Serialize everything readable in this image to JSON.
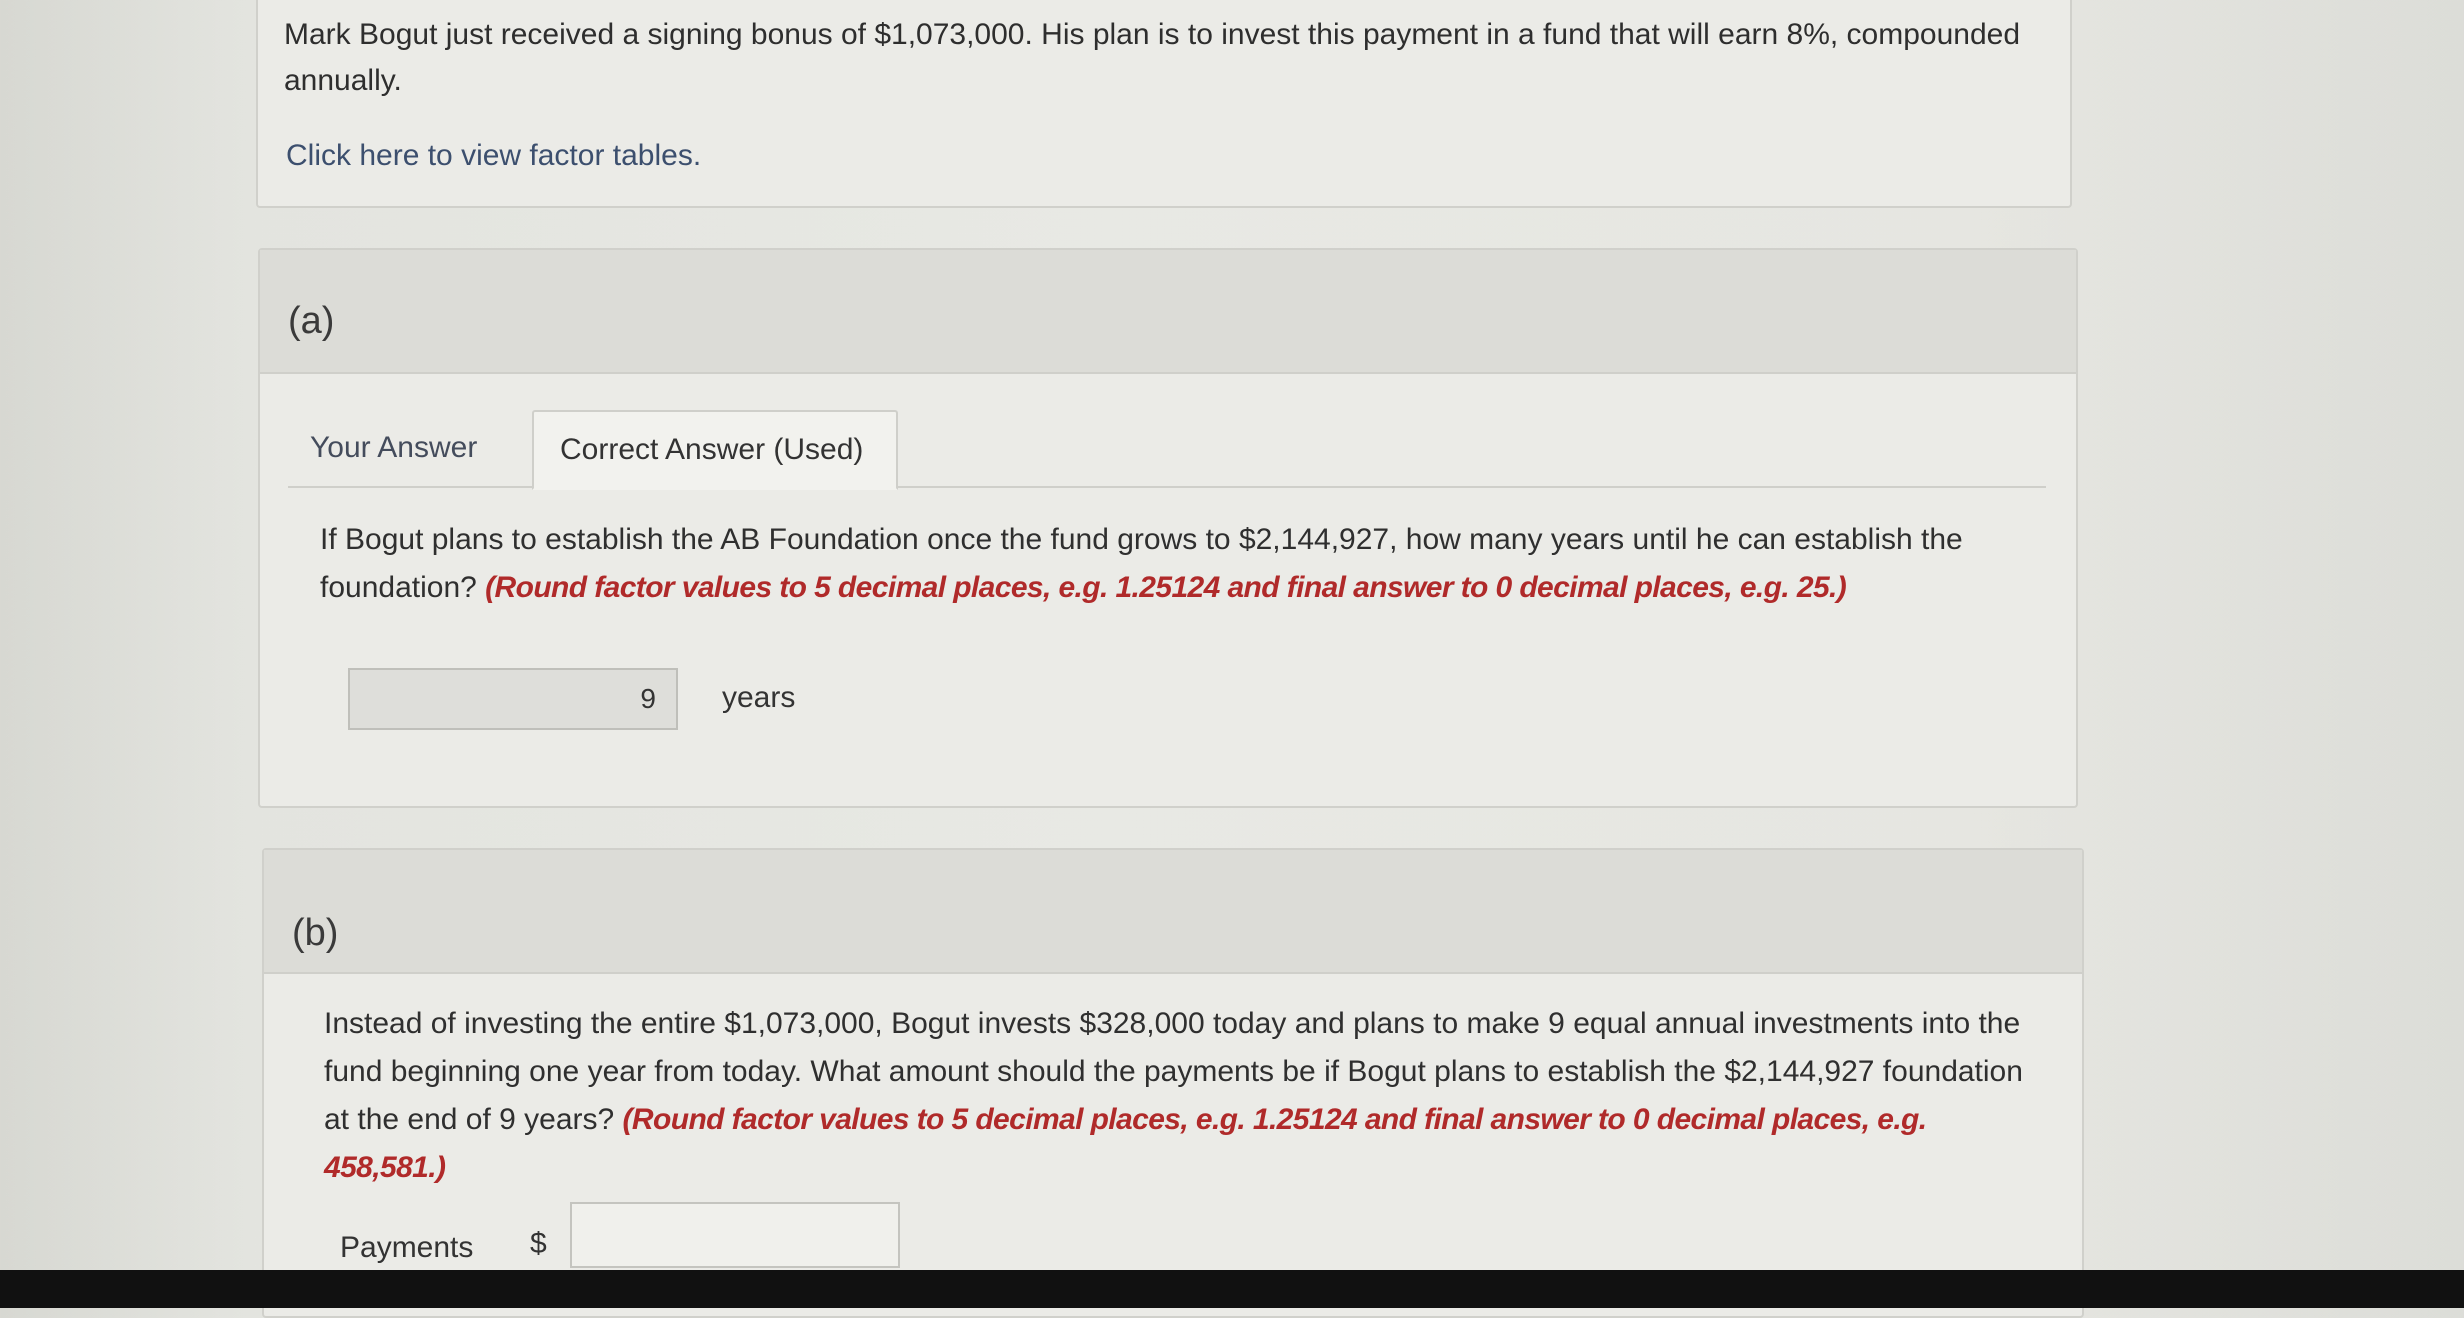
{
  "intro": {
    "text": "Mark Bogut just received a signing bonus of $1,073,000. His plan is to invest this payment in a fund that will earn 8%, compounded annually.",
    "link": "Click here to view factor tables."
  },
  "part_a": {
    "label": "(a)",
    "tabs": [
      "Your Answer",
      "Correct Answer (Used)"
    ],
    "active_tab": "Correct Answer (Used)",
    "question": "If Bogut plans to establish the AB Foundation once the fund grows to $2,144,927, how many years until he can establish the foundation?",
    "hint": "(Round factor values to 5 decimal places, e.g. 1.25124 and final answer to 0 decimal places, e.g. 25.)",
    "answer_value": "9",
    "answer_unit": "years"
  },
  "part_b": {
    "label": "(b)",
    "question": "Instead of investing the entire $1,073,000, Bogut invests $328,000 today and plans to make 9 equal annual investments into the fund beginning one year from today. What amount should the payments be if Bogut plans to establish the $2,144,927 foundation at the end of 9 years?",
    "hint": "(Round factor values to 5 decimal places, e.g. 1.25124 and final answer to 0 decimal places, e.g. 458,581.)",
    "payments_label": "Payments",
    "currency_symbol": "$",
    "payments_value": ""
  }
}
